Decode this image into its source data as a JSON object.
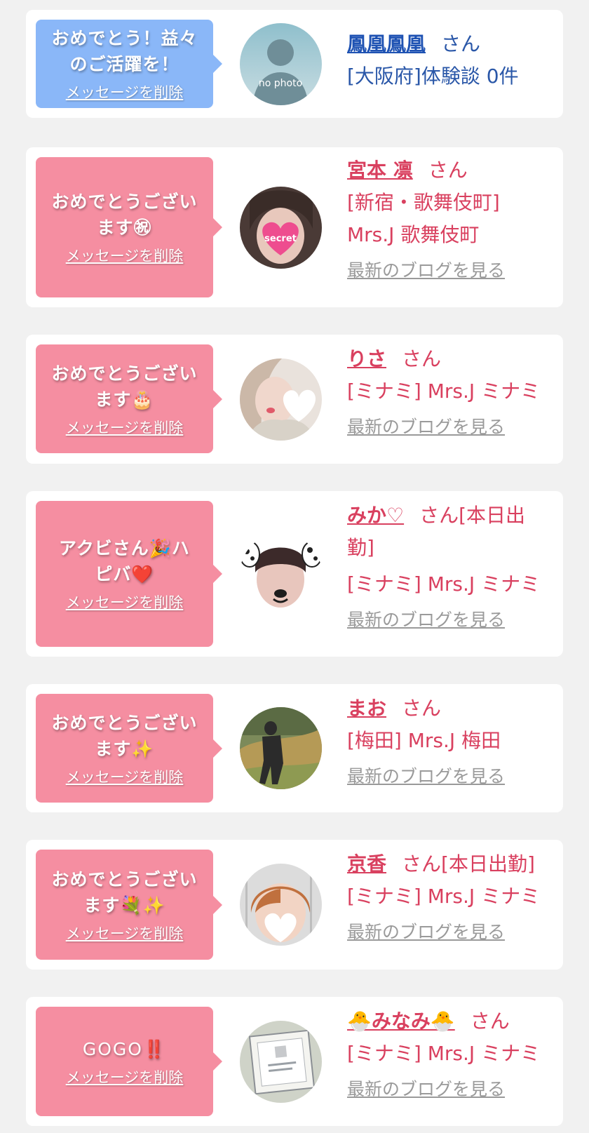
{
  "colors": {
    "background": "#f1f1f1",
    "card": "#ffffff",
    "bubble_blue": "#8ab7f8",
    "bubble_pink": "#f58ea1",
    "text_pink": "#d9405f",
    "text_blue": "#2a57a8",
    "link_gray": "#9a9a9a"
  },
  "common": {
    "san": "さん",
    "delete_label": "メッセージを削除",
    "blog_label": "最新のブログを見る"
  },
  "entries": [
    {
      "message": "おめでとう！益々のご活躍を！",
      "name": "鳳凰鳳凰",
      "location": "[大阪府]体験談 0件",
      "avatar": "no photo",
      "theme": "blue"
    },
    {
      "message": "おめでとうございます㊗",
      "name": "宮本 凛",
      "location": "[新宿・歌舞伎町] Mrs.J 歌舞伎町",
      "avatar": "secret",
      "theme": "pink"
    },
    {
      "message": "おめでとうございます🎂",
      "name": "りさ",
      "location": "[ミナミ] Mrs.J ミナミ",
      "theme": "pink"
    },
    {
      "message": "アクビさん🎉ハピバ❤️",
      "name": "みか♡",
      "attendance": "[本日出勤]",
      "location": "[ミナミ] Mrs.J ミナミ",
      "theme": "pink"
    },
    {
      "message": "おめでとうございます✨",
      "name": "まお",
      "location": "[梅田] Mrs.J 梅田",
      "theme": "pink"
    },
    {
      "message": "おめでとうございます💐✨",
      "name": "京香",
      "attendance": "[本日出勤]",
      "location": "[ミナミ] Mrs.J ミナミ",
      "theme": "pink"
    },
    {
      "message": "GOGO‼️",
      "name": "🐣みなみ🐣",
      "location": "[ミナミ] Mrs.J ミナミ",
      "theme": "pink"
    }
  ]
}
